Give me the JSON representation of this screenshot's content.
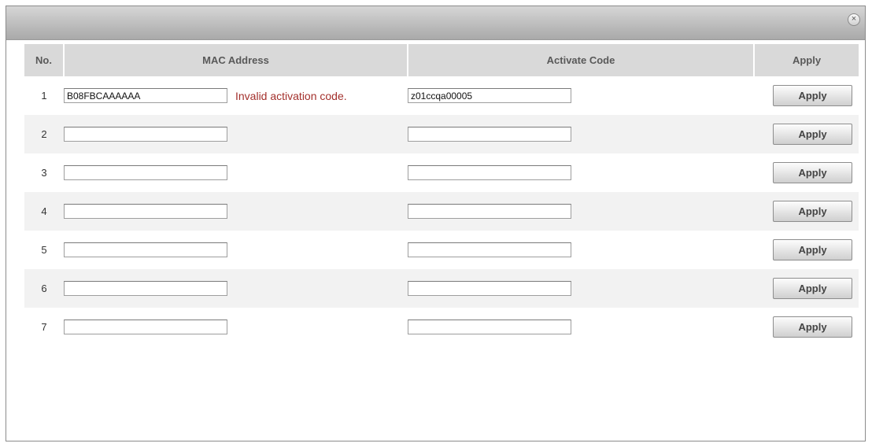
{
  "dialog": {
    "close_icon": "close-icon",
    "close_glyph": "×"
  },
  "table": {
    "headers": {
      "no": "No.",
      "mac": "MAC Address",
      "code": "Activate Code",
      "apply": "Apply"
    },
    "rows": [
      {
        "no": "1",
        "mac": "B08FBCAAAAAA",
        "error": "Invalid activation code.",
        "code": "z01ccqa00005",
        "apply": "Apply"
      },
      {
        "no": "2",
        "mac": "",
        "error": "",
        "code": "",
        "apply": "Apply"
      },
      {
        "no": "3",
        "mac": "",
        "error": "",
        "code": "",
        "apply": "Apply"
      },
      {
        "no": "4",
        "mac": "",
        "error": "",
        "code": "",
        "apply": "Apply"
      },
      {
        "no": "5",
        "mac": "",
        "error": "",
        "code": "",
        "apply": "Apply"
      },
      {
        "no": "6",
        "mac": "",
        "error": "",
        "code": "",
        "apply": "Apply"
      },
      {
        "no": "7",
        "mac": "",
        "error": "",
        "code": "",
        "apply": "Apply"
      }
    ]
  },
  "colors": {
    "error_text": "#a3302c",
    "header_bg": "#d9d9d9",
    "alt_row_bg": "#f2f2f2"
  }
}
